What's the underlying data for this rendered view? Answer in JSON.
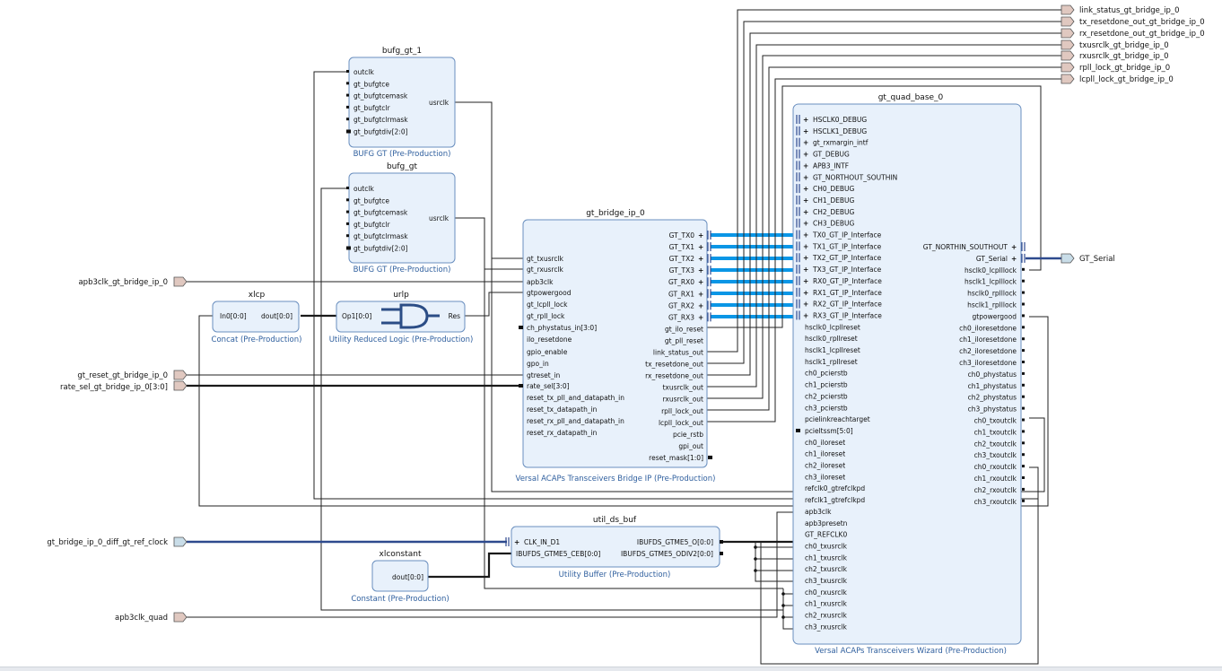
{
  "external_ports": {
    "apb3clk_gt_bridge_ip_0": "apb3clk_gt_bridge_ip_0",
    "gt_reset_gt_bridge_ip_0": "gt_reset_gt_bridge_ip_0",
    "rate_sel_gt_bridge_ip_0": "rate_sel_gt_bridge_ip_0[3:0]",
    "gt_bridge_ip_0_diff_gt_ref_clock": "gt_bridge_ip_0_diff_gt_ref_clock",
    "apb3clk_quad": "apb3clk_quad",
    "gt_serial": "GT_Serial",
    "right_outputs": [
      "link_status_gt_bridge_ip_0",
      "tx_resetdone_out_gt_bridge_ip_0",
      "rx_resetdone_out_gt_bridge_ip_0",
      "txusrclk_gt_bridge_ip_0",
      "rxusrclk_gt_bridge_ip_0",
      "rpll_lock_gt_bridge_ip_0",
      "lcpll_lock_gt_bridge_ip_0"
    ]
  },
  "bufg_gt_1": {
    "name": "bufg_gt_1",
    "subtitle": "BUFG GT (Pre-Production)",
    "inputs": [
      "outclk",
      "gt_bufgtce",
      "gt_bufgtcemask",
      "gt_bufgtclr",
      "gt_bufgtclrmask",
      "gt_bufgtdiv[2:0]"
    ],
    "output": "usrclk"
  },
  "bufg_gt": {
    "name": "bufg_gt",
    "subtitle": "BUFG GT (Pre-Production)",
    "inputs": [
      "outclk",
      "gt_bufgtce",
      "gt_bufgtcemask",
      "gt_bufgtclr",
      "gt_bufgtclrmask",
      "gt_bufgtdiv[2:0]"
    ],
    "output": "usrclk"
  },
  "xlcp": {
    "name": "xlcp",
    "subtitle": "Concat (Pre-Production)",
    "input": "In0[0:0]",
    "output": "dout[0:0]"
  },
  "urlp": {
    "name": "urlp",
    "subtitle": "Utility Reduced Logic (Pre-Production)",
    "input": "Op1[0:0]",
    "output": "Res"
  },
  "gt_bridge_ip_0": {
    "name": "gt_bridge_ip_0",
    "subtitle": "Versal ACAPs Transceivers Bridge IP (Pre-Production)",
    "inputs": [
      "gt_txusrclk",
      "gt_rxusrclk",
      "apb3clk",
      "gtpowergood",
      "gt_lcpll_lock",
      "gt_rpll_lock",
      "ch_phystatus_in[3:0]",
      "ilo_resetdone",
      "gpio_enable",
      "gpo_in",
      "gtreset_in",
      "rate_sel[3:0]",
      "reset_tx_pll_and_datapath_in",
      "reset_tx_datapath_in",
      "reset_rx_pll_and_datapath_in",
      "reset_rx_datapath_in"
    ],
    "outputs": [
      "GT_TX0",
      "GT_TX1",
      "GT_TX2",
      "GT_TX3",
      "GT_RX0",
      "GT_RX1",
      "GT_RX2",
      "GT_RX3",
      "gt_ilo_reset",
      "gt_pll_reset",
      "link_status_out",
      "tx_resetdone_out",
      "rx_resetdone_out",
      "txusrclk_out",
      "rxusrclk_out",
      "rpll_lock_out",
      "lcpll_lock_out",
      "pcie_rstb",
      "gpi_out",
      "reset_mask[1:0]"
    ]
  },
  "gt_quad_base_0": {
    "name": "gt_quad_base_0",
    "subtitle": "Versal ACAPs Transceivers Wizard (Pre-Production)",
    "inputs": [
      "HSCLK0_DEBUG",
      "HSCLK1_DEBUG",
      "gt_rxmargin_intf",
      "GT_DEBUG",
      "APB3_INTF",
      "GT_NORTHOUT_SOUTHIN",
      "CH0_DEBUG",
      "CH1_DEBUG",
      "CH2_DEBUG",
      "CH3_DEBUG",
      "TX0_GT_IP_Interface",
      "TX1_GT_IP_Interface",
      "TX2_GT_IP_Interface",
      "TX3_GT_IP_Interface",
      "RX0_GT_IP_Interface",
      "RX1_GT_IP_Interface",
      "RX2_GT_IP_Interface",
      "RX3_GT_IP_Interface",
      "hsclk0_lcpllreset",
      "hsclk0_rpllreset",
      "hsclk1_lcpllreset",
      "hsclk1_rpllreset",
      "ch0_pcierstb",
      "ch1_pcierstb",
      "ch2_pcierstb",
      "ch3_pcierstb",
      "pcielinkreachtarget",
      "pcieltssm[5:0]",
      "ch0_iloreset",
      "ch1_iloreset",
      "ch2_iloreset",
      "ch3_iloreset",
      "refclk0_gtrefclkpd",
      "refclk1_gtrefclkpd",
      "apb3clk",
      "apb3presetn",
      "GT_REFCLK0",
      "ch0_txusrclk",
      "ch1_txusrclk",
      "ch2_txusrclk",
      "ch3_txusrclk",
      "ch0_rxusrclk",
      "ch1_rxusrclk",
      "ch2_rxusrclk",
      "ch3_rxusrclk"
    ],
    "outputs": [
      "GT_NORTHIN_SOUTHOUT",
      "GT_Serial",
      "hsclk0_lcplllock",
      "hsclk1_lcplllock",
      "hsclk0_rplllock",
      "hsclk1_rplllock",
      "gtpowergood",
      "ch0_iloresetdone",
      "ch1_iloresetdone",
      "ch2_iloresetdone",
      "ch3_iloresetdone",
      "ch0_phystatus",
      "ch1_phystatus",
      "ch2_phystatus",
      "ch3_phystatus",
      "ch0_txoutclk",
      "ch1_txoutclk",
      "ch2_txoutclk",
      "ch3_txoutclk",
      "ch0_rxoutclk",
      "ch1_rxoutclk",
      "ch2_rxoutclk",
      "ch3_rxoutclk"
    ]
  },
  "util_ds_buf": {
    "name": "util_ds_buf",
    "subtitle": "Utility Buffer (Pre-Production)",
    "inputs": [
      "CLK_IN_D1",
      "IBUFDS_GTME5_CEB[0:0]"
    ],
    "outputs": [
      "IBUFDS_GTME5_O[0:0]",
      "IBUFDS_GTME5_ODIV2[0:0]"
    ]
  },
  "xlconstant": {
    "name": "xlconstant",
    "subtitle": "Constant (Pre-Production)",
    "output": "dout[0:0]"
  }
}
